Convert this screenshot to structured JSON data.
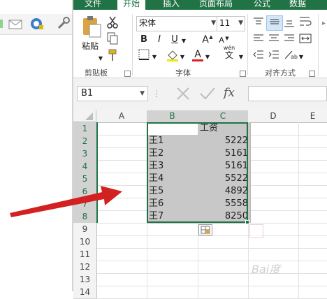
{
  "ribbon": {
    "tabs": [
      "文件",
      "开始",
      "插入",
      "页面布局",
      "公式",
      "数据"
    ],
    "font_name": "宋体",
    "font_size": "11",
    "paste_label": "粘贴",
    "groups": {
      "clipboard": "剪贴板",
      "font": "字体",
      "align": "对齐方式"
    },
    "bold": "B",
    "italic": "I",
    "underline": "U",
    "grow_font": "A",
    "shrink_font": "A",
    "wen": "wén",
    "wen_char": "文",
    "font_color_a": "A"
  },
  "formula_bar": {
    "name_box": "B1",
    "fx": "fx"
  },
  "sheet": {
    "columns": [
      "A",
      "B",
      "C",
      "D",
      "E"
    ],
    "rows": [
      "1",
      "2",
      "3",
      "4",
      "5",
      "6",
      "7",
      "8",
      "9",
      "10",
      "11",
      "12",
      "13",
      "14"
    ],
    "c1": "工资",
    "names": [
      "王1",
      "王2",
      "王3",
      "王4",
      "王5",
      "王6",
      "王7"
    ],
    "salaries": [
      "5222",
      "5161",
      "5161",
      "5522",
      "4892",
      "5558",
      "8250"
    ]
  },
  "watermark": "Bai度",
  "colors": {
    "excel_green": "#217346",
    "arrow_red": "#d32020",
    "selection": "#c8c8c8"
  }
}
